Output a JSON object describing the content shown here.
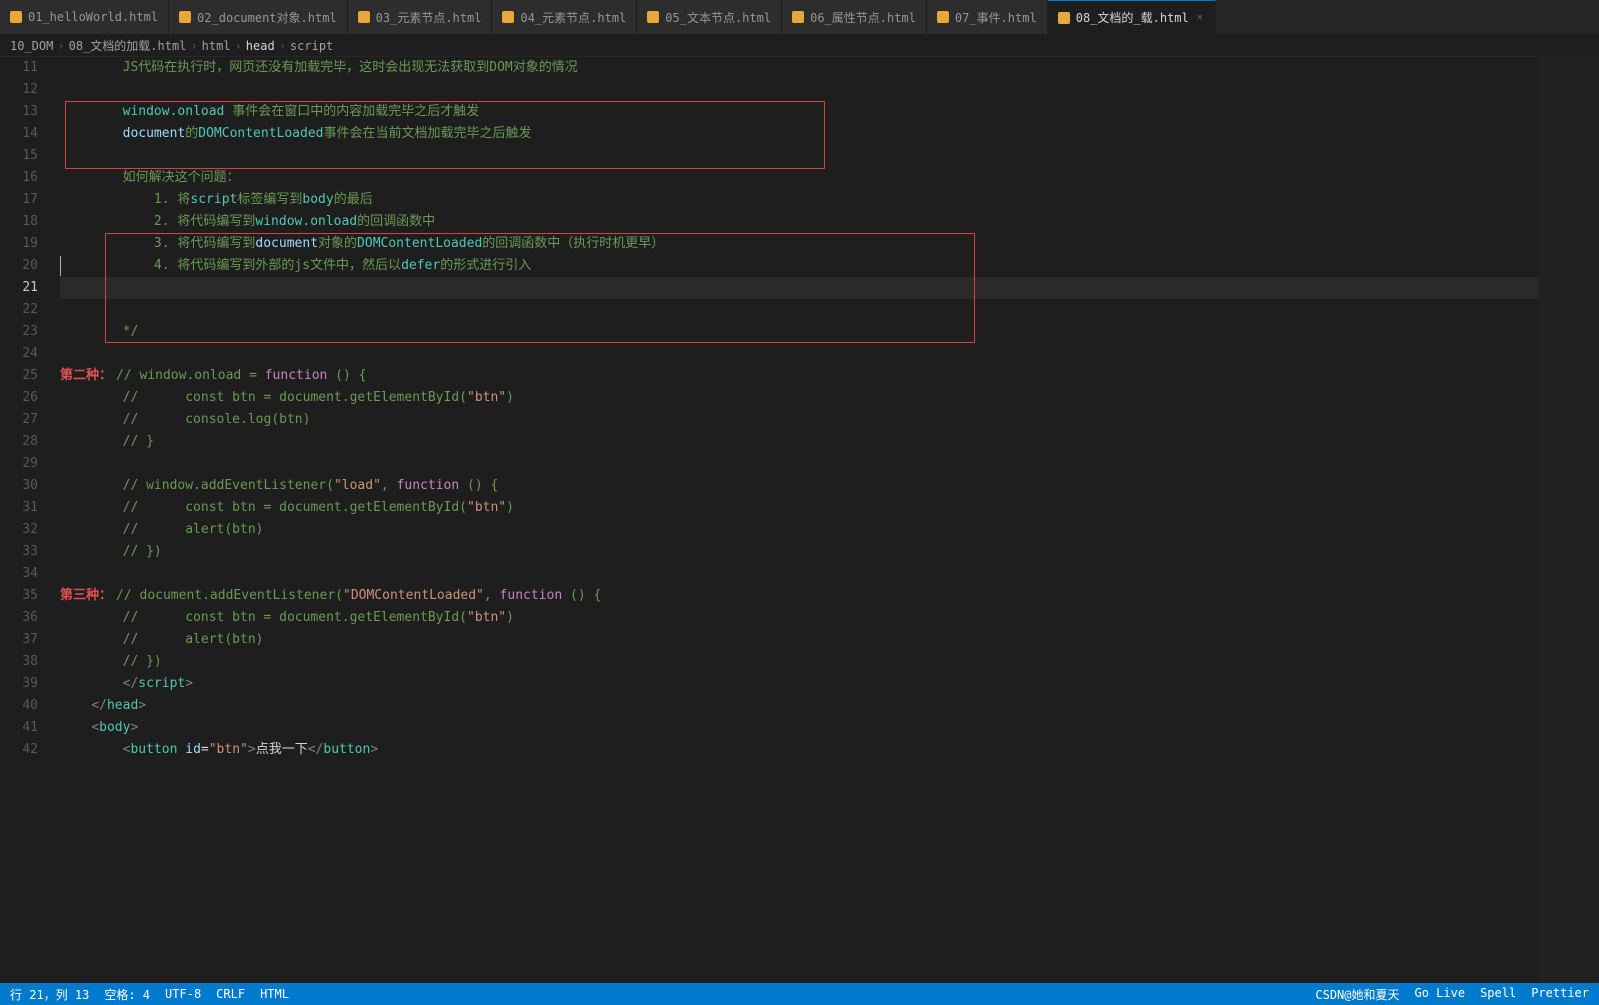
{
  "tabs": [
    {
      "id": "t1",
      "label": "01_helloWorld.html",
      "color": "orange",
      "active": false
    },
    {
      "id": "t2",
      "label": "02_document对象.html",
      "color": "orange",
      "active": false
    },
    {
      "id": "t3",
      "label": "03_元素节点.html",
      "color": "orange",
      "active": false
    },
    {
      "id": "t4",
      "label": "04_元素节点.html",
      "color": "orange",
      "active": false
    },
    {
      "id": "t5",
      "label": "05_文本节点.html",
      "color": "orange",
      "active": false
    },
    {
      "id": "t6",
      "label": "06_属性节点.html",
      "color": "orange",
      "active": false
    },
    {
      "id": "t7",
      "label": "07_事件.html",
      "color": "orange",
      "active": false
    },
    {
      "id": "t8",
      "label": "08_文档的_载.html",
      "color": "orange",
      "active": true
    }
  ],
  "breadcrumb": [
    "10_DOM",
    "08_文档的加载.html",
    "html",
    "head",
    "script"
  ],
  "status": {
    "line": "行 21，列 13",
    "spaces": "空格: 4",
    "encoding": "UTF-8",
    "eol": "CRLF",
    "language": "HTML",
    "extra": "CSDN@她和夏天",
    "right_items": [
      "Go Live",
      "Spell",
      "Prettier"
    ]
  },
  "lines": {
    "start": 11,
    "end": 42
  }
}
